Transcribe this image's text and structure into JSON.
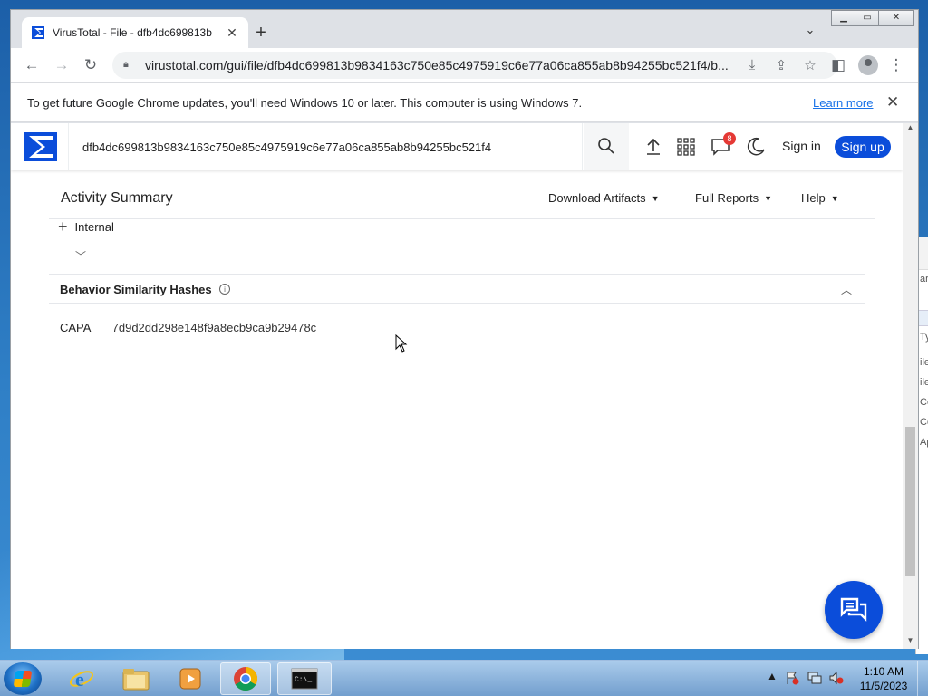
{
  "browser": {
    "tab_title": "VirusTotal - File - dfb4dc699813b",
    "url": "virustotal.com/gui/file/dfb4dc699813b9834163c750e85c4975919c6e77a06ca855ab8b94255bc521f4/b...",
    "infobar_message": "To get future Google Chrome updates, you'll need Windows 10 or later. This computer is using Windows 7.",
    "infobar_link": "Learn more"
  },
  "vt": {
    "search_query": "dfb4dc699813b9834163c750e85c4975919c6e77a06ca855ab8b94255bc521f4",
    "notification_count": "8",
    "signin_label": "Sign in",
    "signup_label": "Sign up",
    "accent_color": "#0b4dda"
  },
  "page": {
    "section_title": "Activity Summary",
    "menus": [
      "Download Artifacts",
      "Full Reports",
      "Help"
    ],
    "internal_label": "Internal",
    "bsh_title": "Behavior Similarity Hashes",
    "hashes": [
      {
        "key": "CAPA",
        "value": "7d9d2dd298e148f9a8ecb9ca9b29478c"
      }
    ]
  },
  "background_window": {
    "fragments": [
      "ar",
      "Ty",
      "ile",
      "ile",
      "Co",
      "Co",
      "Ap"
    ]
  },
  "taskbar": {
    "time": "1:10 AM",
    "date": "11/5/2023"
  }
}
